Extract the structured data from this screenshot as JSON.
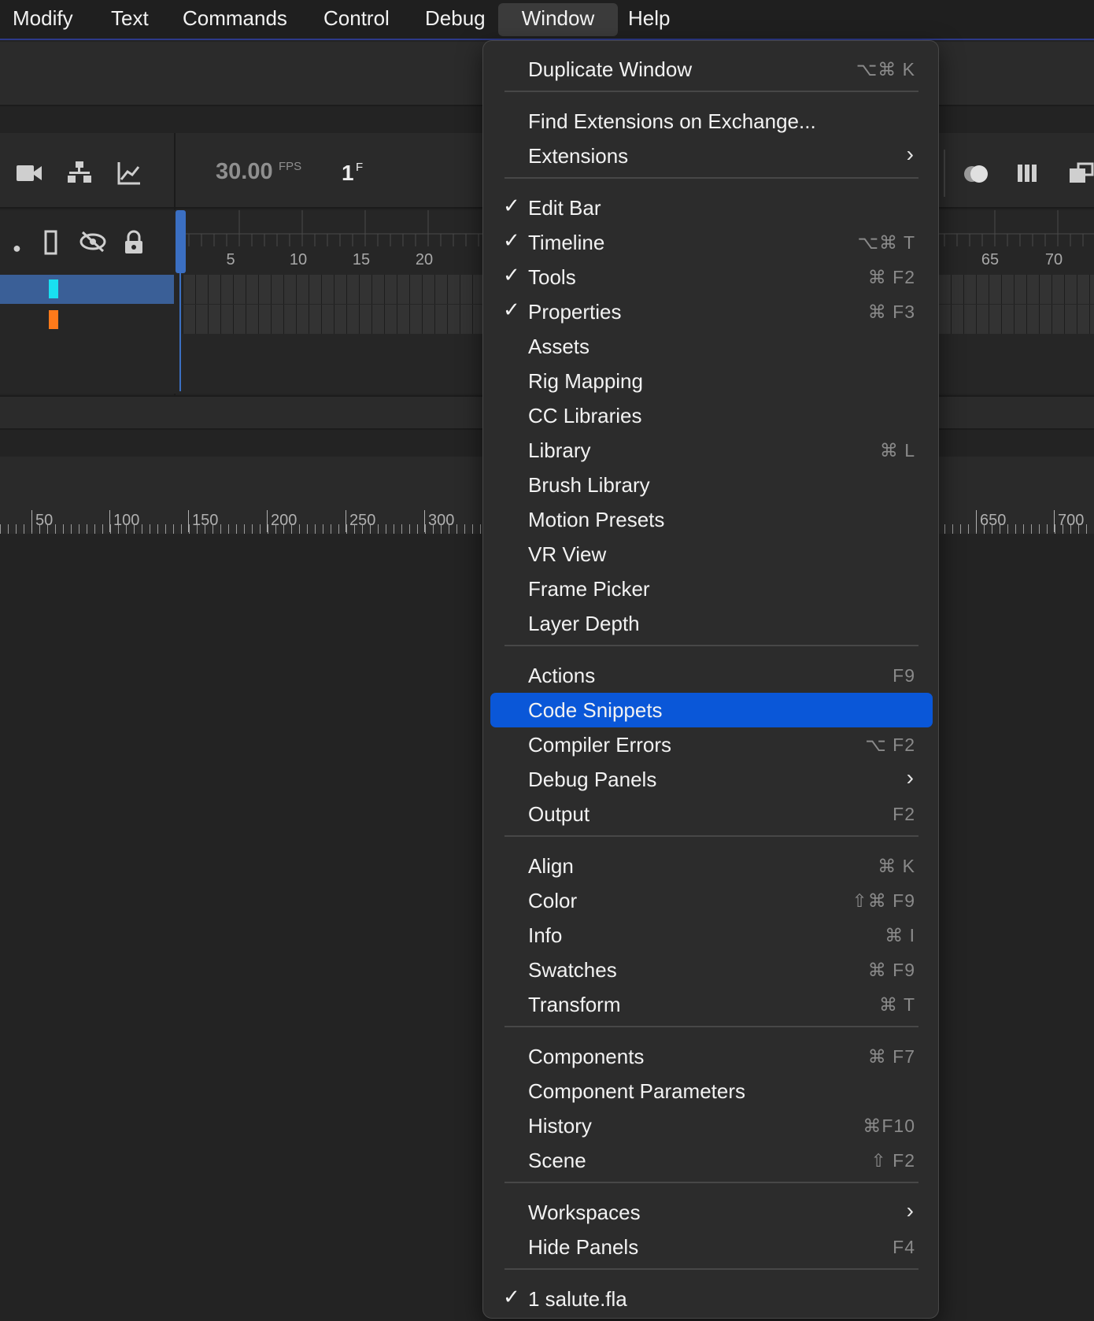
{
  "menubar": {
    "items": [
      "Modify",
      "Text",
      "Commands",
      "Control",
      "Debug",
      "Window",
      "Help"
    ],
    "active": "Window"
  },
  "timeline": {
    "fps_value": "30.00",
    "fps_label": "FPS",
    "frame_value": "1",
    "frame_label": "F",
    "frame_numbers": [
      "5",
      "10",
      "15",
      "20",
      "65",
      "70"
    ],
    "layer_colors": [
      "#19e0f0",
      "#ff7a1a"
    ]
  },
  "stage_ruler": {
    "labels": [
      "50",
      "100",
      "150",
      "200",
      "250",
      "300",
      "650",
      "700"
    ]
  },
  "window_menu": {
    "items": [
      {
        "label": "Duplicate Window",
        "shortcut": "⌥⌘ K"
      },
      {
        "label": "Find Extensions on Exchange...",
        "shortcut": ""
      },
      {
        "label": "Extensions",
        "shortcut": "",
        "submenu": true
      },
      {
        "label": "Edit Bar",
        "shortcut": "",
        "checked": true
      },
      {
        "label": "Timeline",
        "shortcut": "⌥⌘ T",
        "checked": true
      },
      {
        "label": "Tools",
        "shortcut": "⌘ F2",
        "checked": true
      },
      {
        "label": "Properties",
        "shortcut": "⌘ F3",
        "checked": true
      },
      {
        "label": "Assets",
        "shortcut": ""
      },
      {
        "label": "Rig Mapping",
        "shortcut": ""
      },
      {
        "label": "CC Libraries",
        "shortcut": ""
      },
      {
        "label": "Library",
        "shortcut": "⌘ L"
      },
      {
        "label": "Brush Library",
        "shortcut": ""
      },
      {
        "label": "Motion Presets",
        "shortcut": ""
      },
      {
        "label": "VR View",
        "shortcut": ""
      },
      {
        "label": "Frame Picker",
        "shortcut": ""
      },
      {
        "label": "Layer Depth",
        "shortcut": ""
      },
      {
        "label": "Actions",
        "shortcut": "F9"
      },
      {
        "label": "Code Snippets",
        "shortcut": "",
        "highlighted": true
      },
      {
        "label": "Compiler Errors",
        "shortcut": "⌥ F2"
      },
      {
        "label": "Debug Panels",
        "shortcut": "",
        "submenu": true
      },
      {
        "label": "Output",
        "shortcut": "F2"
      },
      {
        "label": "Align",
        "shortcut": "⌘ K"
      },
      {
        "label": "Color",
        "shortcut": "⇧⌘ F9"
      },
      {
        "label": "Info",
        "shortcut": "⌘ I"
      },
      {
        "label": "Swatches",
        "shortcut": "⌘ F9"
      },
      {
        "label": "Transform",
        "shortcut": "⌘ T"
      },
      {
        "label": "Components",
        "shortcut": "⌘ F7"
      },
      {
        "label": "Component Parameters",
        "shortcut": ""
      },
      {
        "label": "History",
        "shortcut": "⌘F10"
      },
      {
        "label": "Scene",
        "shortcut": "⇧ F2"
      },
      {
        "label": "Workspaces",
        "shortcut": "",
        "submenu": true
      },
      {
        "label": "Hide Panels",
        "shortcut": "F4"
      },
      {
        "label": "1 salute.fla",
        "shortcut": "",
        "checked": true
      }
    ]
  },
  "glyphs": {
    "check": "✓",
    "submenu_arrow": "›"
  },
  "icons": [
    "camera-icon",
    "layer-hierarchy-icon",
    "graph-icon",
    "dot-icon",
    "outline-icon",
    "hide-icon",
    "lock-icon",
    "onion-skin-icon",
    "frames-icon",
    "export-icon"
  ]
}
